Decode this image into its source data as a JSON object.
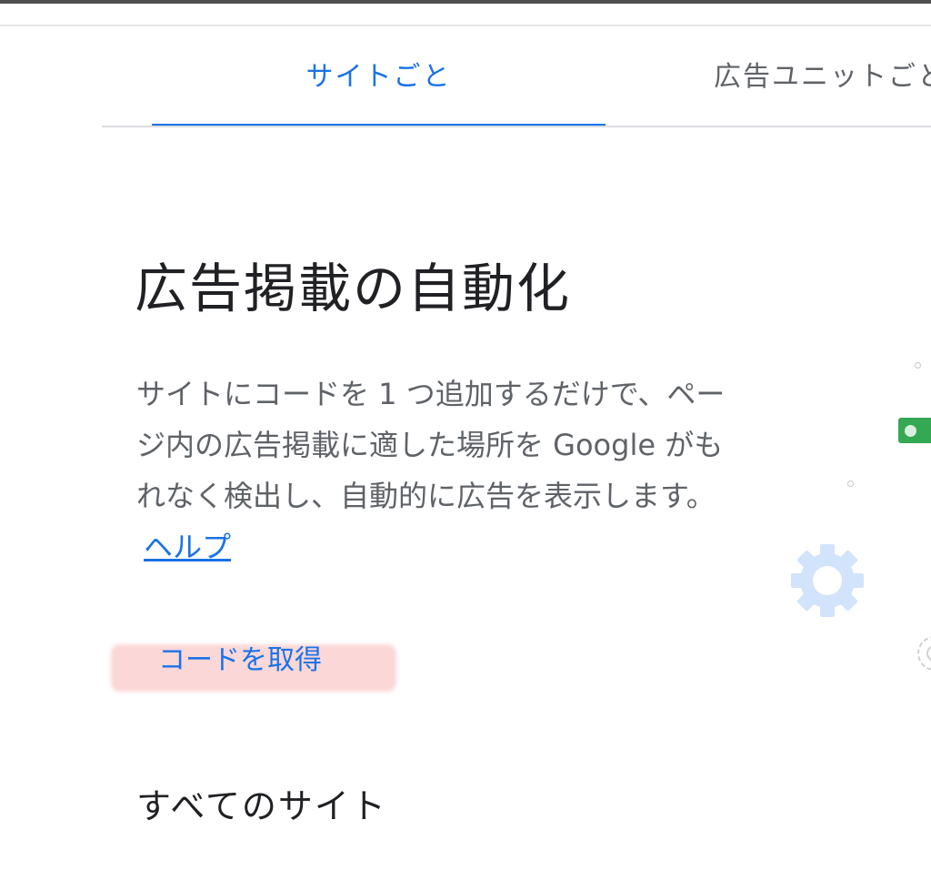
{
  "tabs": [
    {
      "label": "サイトごと",
      "active": true
    },
    {
      "label": "広告ユニットごと",
      "active": false
    }
  ],
  "title": "広告掲載の自動化",
  "description": {
    "text": "サイトにコードを 1 つ追加するだけで、ページ内の広告掲載に適した場所を Google がもれなく検出し、自動的に広告を表示します。",
    "help_link": "ヘルプ"
  },
  "actions": {
    "get_code_label": "コードを取得"
  },
  "sections": {
    "all_sites_title": "すべてのサイト"
  },
  "colors": {
    "accent": "#1a73e8",
    "highlight": "#fbd7d7",
    "badge_green": "#34a853",
    "gear_blue": "#d2e3fc"
  },
  "icons": [
    "gear-icon",
    "toggle-icon"
  ]
}
